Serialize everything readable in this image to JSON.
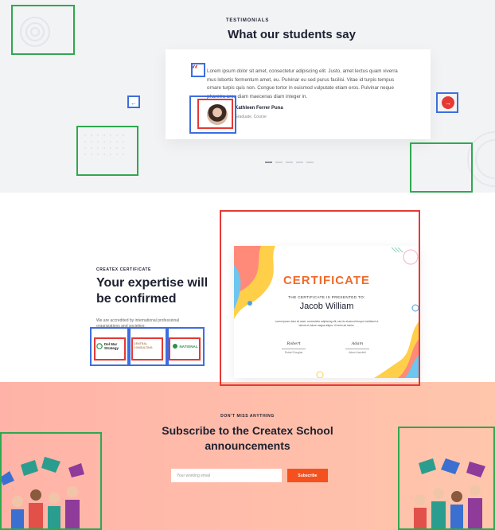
{
  "testimonials": {
    "eyebrow": "TESTIMONIALS",
    "title": "What our students say",
    "quote_mark": "“",
    "text": "Lorem ipsum dolor sit amet, consectetur adipiscing elit. Justo, amet lectus quam viverra mus lobortis fermentum amet, eu. Pulvinar eu sed purus facilisi. Vitae id turpis tempus ornare turpis quis non. Congue tortor in euismod vulputate etiam eros. Pulvinar neque pharetra arcu diam maecenas diam integer in.",
    "author_name": "Kathleen Ferrer Puna",
    "author_role": "Graduate, Course",
    "prev_icon": "←",
    "next_icon": "→",
    "accent": "#e53935"
  },
  "certificate": {
    "eyebrow": "CREATEX CERTIFICATE",
    "title": "Your expertise will be confirmed",
    "description": "We are accredited by international professional organizations and societies:",
    "logos": [
      {
        "label": "Del Mar Strategy"
      },
      {
        "label": "CENTRAL CONSULTING"
      },
      {
        "label": "NATIONAL"
      }
    ],
    "card": {
      "heading": "CERTIFICATE",
      "subtitle": "THE CERTIFICATE IS PRESENTED TO:",
      "recipient": "Jacob William",
      "body": "Lorem ipsum dolor sit amet, consectetur adipiscing elit, sed do eiusmod tempor incididunt ut labore et dolore magna aliqua. Ut enim ad minim.",
      "sig_left": "Robert",
      "sig_left_name": "Robert Douglas",
      "sig_right": "Adam",
      "sig_right_name": "Adam Kaccfeld"
    }
  },
  "subscribe": {
    "eyebrow": "DON'T MISS ANYTHING",
    "title": "Subscribe to the Createx School announcements",
    "input_placeholder": "Your working email",
    "button_label": "Subscribe",
    "button_color": "#f4511e"
  }
}
